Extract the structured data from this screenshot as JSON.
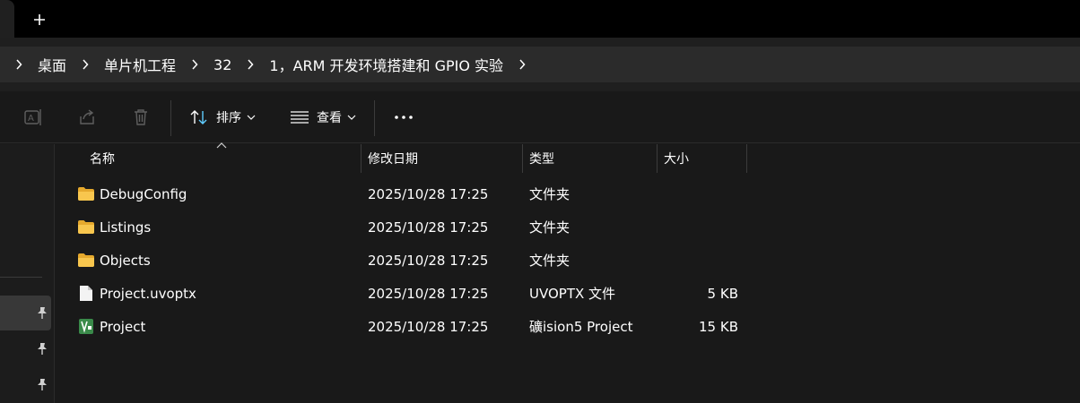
{
  "window": {
    "breadcrumb": [
      "桌面",
      "单片机工程",
      "32",
      "1，ARM 开发环境搭建和 GPIO 实验"
    ]
  },
  "toolbar": {
    "sort_label": "排序",
    "view_label": "查看"
  },
  "columns": {
    "name": "名称",
    "date": "修改日期",
    "type": "类型",
    "size": "大小"
  },
  "files": [
    {
      "name": "DebugConfig",
      "date": "2025/10/28 17:25",
      "type": "文件夹",
      "size": "",
      "icon": "folder-icon"
    },
    {
      "name": "Listings",
      "date": "2025/10/28 17:25",
      "type": "文件夹",
      "size": "",
      "icon": "folder-icon"
    },
    {
      "name": "Objects",
      "date": "2025/10/28 17:25",
      "type": "文件夹",
      "size": "",
      "icon": "folder-icon"
    },
    {
      "name": "Project.uvoptx",
      "date": "2025/10/28 17:25",
      "type": "UVOPTX 文件",
      "size": "5 KB",
      "icon": "file-icon"
    },
    {
      "name": "Project",
      "date": "2025/10/28 17:25",
      "type": "礦ision5 Project",
      "size": "15 KB",
      "icon": "keil-project-icon"
    }
  ],
  "theme": {
    "folder_color": "#f8c64e",
    "accent": "#60cdff"
  }
}
